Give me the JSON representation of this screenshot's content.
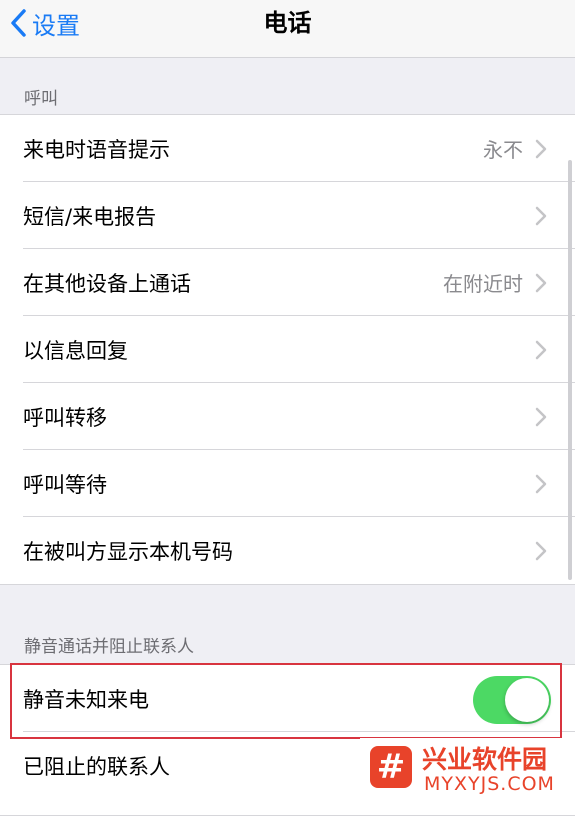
{
  "navbar": {
    "back_label": "设置",
    "title": "电话"
  },
  "sections": [
    {
      "header": "呼叫",
      "rows": [
        {
          "label": "来电时语音提示",
          "value": "永不"
        },
        {
          "label": "短信/来电报告",
          "value": ""
        },
        {
          "label": "在其他设备上通话",
          "value": "在附近时"
        },
        {
          "label": "以信息回复",
          "value": ""
        },
        {
          "label": "呼叫转移",
          "value": ""
        },
        {
          "label": "呼叫等待",
          "value": ""
        },
        {
          "label": "在被叫方显示本机号码",
          "value": ""
        }
      ]
    },
    {
      "header": "静音通话并阻止联系人",
      "rows": [
        {
          "label": "静音未知来电",
          "toggle_on": true
        },
        {
          "label": "已阻止的联系人"
        }
      ]
    }
  ],
  "watermark": {
    "logo_glyph": "#",
    "name": "兴业软件园",
    "url": "MYXYJS.COM"
  },
  "colors": {
    "accent": "#1a7bf5",
    "toggle_on": "#4cd964",
    "highlight_border": "#d8343f",
    "watermark": "#e8432a"
  }
}
